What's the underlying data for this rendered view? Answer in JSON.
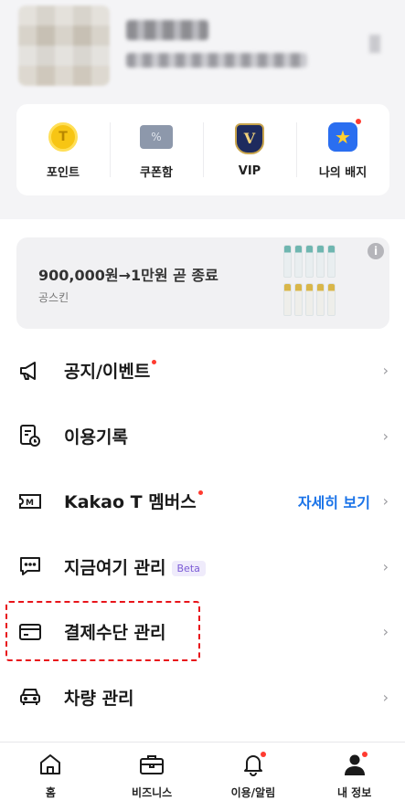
{
  "quick_menu": {
    "items": [
      {
        "label": "포인트",
        "icon": "point-coin-icon",
        "glyph": "T"
      },
      {
        "label": "쿠폰함",
        "icon": "coupon-icon",
        "glyph": "%"
      },
      {
        "label": "VIP",
        "icon": "vip-badge-icon",
        "glyph": "V"
      },
      {
        "label": "나의 배지",
        "icon": "my-badge-icon",
        "glyph": "★",
        "has_dot": true
      }
    ]
  },
  "banner": {
    "title": "900,000원→1만원 곧 종료",
    "subtitle": "공스킨",
    "info_glyph": "i"
  },
  "menu": {
    "items": [
      {
        "label": "공지/이벤트",
        "icon": "megaphone-icon",
        "has_dot": true
      },
      {
        "label": "이용기록",
        "icon": "history-icon"
      },
      {
        "label": "Kakao T 멤버스",
        "icon": "membership-icon",
        "has_dot": true,
        "link": "자세히 보기"
      },
      {
        "label": "지금여기 관리",
        "icon": "chat-icon",
        "badge": "Beta"
      },
      {
        "label": "결제수단 관리",
        "icon": "card-icon"
      },
      {
        "label": "차량 관리",
        "icon": "car-icon"
      }
    ],
    "chevron": "›"
  },
  "tabbar": {
    "items": [
      {
        "label": "홈",
        "icon": "home-icon"
      },
      {
        "label": "비즈니스",
        "icon": "briefcase-icon"
      },
      {
        "label": "이용/알림",
        "icon": "bell-icon",
        "has_dot": true
      },
      {
        "label": "내 정보",
        "icon": "profile-icon",
        "has_dot": true,
        "active": true
      }
    ]
  },
  "colors": {
    "accent_blue": "#1a73e8",
    "alert_red": "#ff3b30",
    "beta_purple": "#7b5bd6"
  }
}
